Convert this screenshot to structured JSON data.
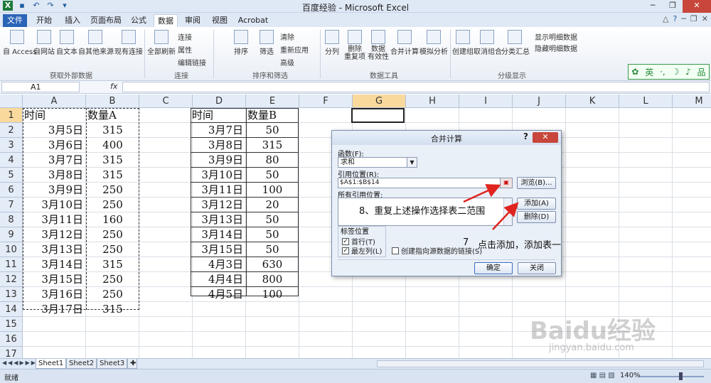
{
  "window": {
    "title": "百度经验 - Microsoft Excel"
  },
  "ribbon_tabs": [
    "文件",
    "开始",
    "插入",
    "页面布局",
    "公式",
    "数据",
    "审阅",
    "视图",
    "Acrobat"
  ],
  "ribbon": {
    "ext_data": [
      "自 Access",
      "自网站",
      "自文本",
      "自其他来源",
      "现有连接"
    ],
    "ext_group": "获取外部数据",
    "refresh_all": "全部刷新",
    "conn_small": [
      "连接",
      "属性",
      "编辑链接"
    ],
    "conn_group": "连接",
    "sort": "排序",
    "filter": "筛选",
    "filter_small": [
      "清除",
      "重新应用",
      "高级"
    ],
    "sort_group": "排序和筛选",
    "tools": [
      "分列",
      "删除\n重复项",
      "数据\n有效性",
      "合并计算",
      "模拟分析"
    ],
    "tools_group": "数据工具",
    "outline": [
      "创建组",
      "取消组合",
      "分类汇总"
    ],
    "outline_small": [
      "显示明细数据",
      "隐藏明细数据"
    ],
    "outline_group": "分级显示",
    "badge": [
      "英",
      "·,",
      "☽",
      "♪",
      "品"
    ]
  },
  "formula_bar": {
    "name_box": "A1",
    "fx": "fx",
    "value": ""
  },
  "columns": [
    "A",
    "B",
    "C",
    "D",
    "E",
    "F",
    "G",
    "H",
    "I",
    "J",
    "K",
    "L",
    "M"
  ],
  "rows": [
    "1",
    "2",
    "3",
    "4",
    "5",
    "6",
    "7",
    "8",
    "9",
    "10",
    "11",
    "12",
    "13",
    "14",
    "15",
    "16",
    "17"
  ],
  "table_a": {
    "header": [
      "时间",
      "数量A"
    ],
    "rows": [
      [
        "3月5日",
        "315"
      ],
      [
        "3月6日",
        "400"
      ],
      [
        "3月7日",
        "315"
      ],
      [
        "3月8日",
        "315"
      ],
      [
        "3月9日",
        "250"
      ],
      [
        "3月10日",
        "250"
      ],
      [
        "3月11日",
        "160"
      ],
      [
        "3月12日",
        "250"
      ],
      [
        "3月13日",
        "250"
      ],
      [
        "3月14日",
        "315"
      ],
      [
        "3月15日",
        "250"
      ],
      [
        "3月16日",
        "250"
      ],
      [
        "3月17日",
        "315"
      ]
    ]
  },
  "table_b": {
    "header": [
      "时间",
      "数量B"
    ],
    "rows": [
      [
        "3月7日",
        "50"
      ],
      [
        "3月8日",
        "315"
      ],
      [
        "3月9日",
        "80"
      ],
      [
        "3月10日",
        "50"
      ],
      [
        "3月11日",
        "100"
      ],
      [
        "3月12日",
        "20"
      ],
      [
        "3月13日",
        "50"
      ],
      [
        "3月14日",
        "50"
      ],
      [
        "3月15日",
        "50"
      ],
      [
        "4月3日",
        "630"
      ],
      [
        "4月4日",
        "800"
      ],
      [
        "4月5日",
        "100"
      ]
    ]
  },
  "dialog": {
    "title": "合并计算",
    "help": "?",
    "close": "✕",
    "function_label": "函数(F):",
    "function_value": "求和",
    "ref_label": "引用位置(R):",
    "ref_value": "$A$1:$B$14",
    "browse": "浏览(B)...",
    "all_refs_label": "所有引用位置:",
    "add": "添加(A)",
    "delete": "删除(D)",
    "label_pos": "标签位置",
    "first_row": "首行(T)",
    "left_col": "最左列(L)",
    "link": "创建指向源数据的链接(S)",
    "ok": "确定",
    "cancel": "关闭"
  },
  "annotations": {
    "step8": "8、重复上述操作选择表二范围",
    "step7_num": "7",
    "step7": "点击添加，添加表一"
  },
  "sheets": [
    "Sheet1",
    "Sheet2",
    "Sheet3"
  ],
  "status": {
    "ready": "就绪",
    "zoom": "140%"
  },
  "watermark": {
    "main": "Baidu经验",
    "url": "jingyan.baidu.com"
  }
}
